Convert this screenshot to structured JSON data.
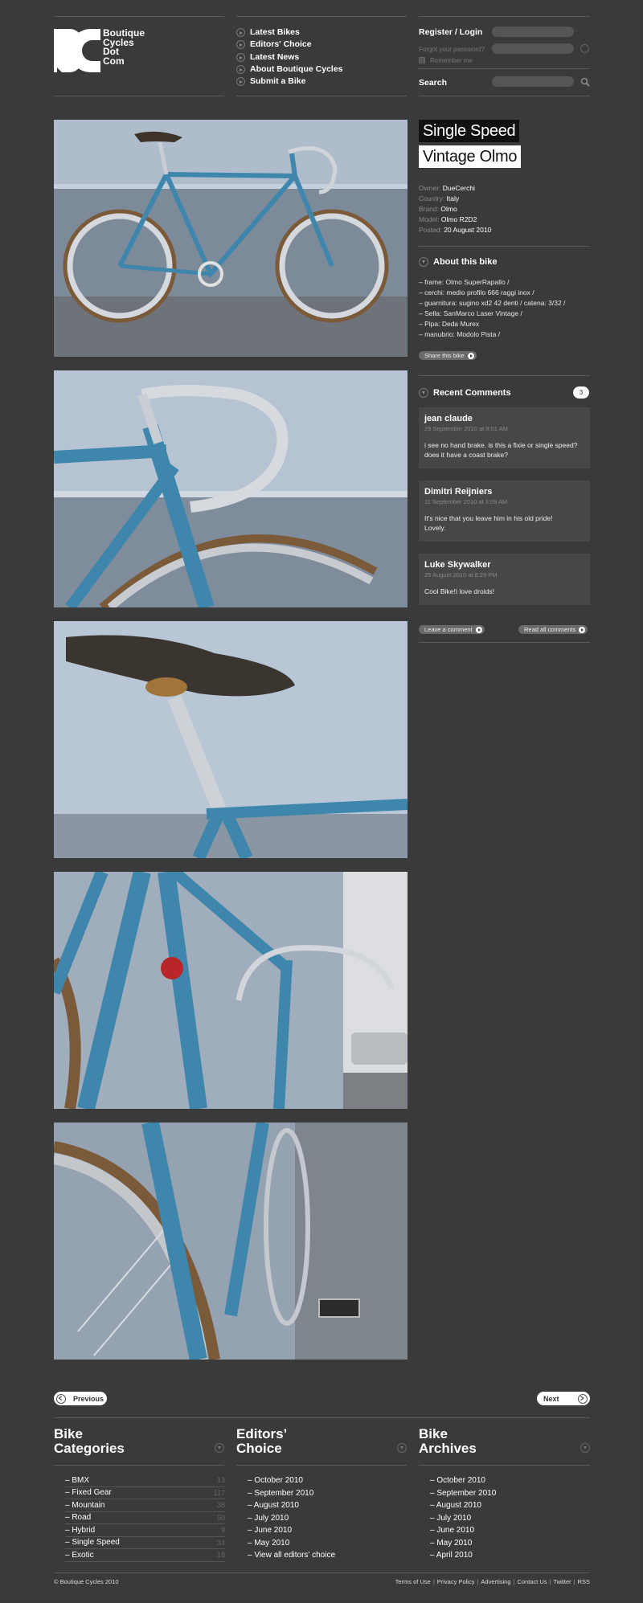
{
  "brand": {
    "line1": "Boutique",
    "line2": "Cycles",
    "line3": "Dot",
    "line4": "Com"
  },
  "nav": [
    {
      "label": "Latest Bikes"
    },
    {
      "label": "Editors' Choice"
    },
    {
      "label": "Latest News"
    },
    {
      "label": "About Boutique Cycles"
    },
    {
      "label": "Submit a Bike"
    }
  ],
  "login": {
    "title": "Register / Login",
    "forgot": "Forgot your password?",
    "remember": "Remember me",
    "search_label": "Search"
  },
  "bike": {
    "title_line1": "Single Speed",
    "title_line2": "Vintage Olmo",
    "meta": [
      {
        "key": "Owner:",
        "value": "DueCerchi"
      },
      {
        "key": "Country:",
        "value": "Italy"
      },
      {
        "key": "Brand:",
        "value": "Olmo"
      },
      {
        "key": "Model:",
        "value": "Olmo R2D2"
      },
      {
        "key": "Posted:",
        "value": "20 August 2010"
      }
    ],
    "about_title": "About this bike",
    "specs": [
      "– frame: Olmo SuperRapallo /",
      "– cerchi: medio profilo 666 raggi inox /",
      "– guarnitura: sugino xd2 42 denti / catena: 3/32 /",
      "– Sella: SanMarco Laser Vintage /",
      "– Pipa: Deda Murex",
      "– manubrio: Modolo Pista /"
    ],
    "share_label": "Share this bike"
  },
  "comments": {
    "title": "Recent Comments",
    "count": "3",
    "items": [
      {
        "name": "jean claude",
        "date": "29 September 2010  at  9:01 AM",
        "text_line1": "i see no hand brake. is this a fixie or single speed?",
        "text_line2": "does it have a coast brake?"
      },
      {
        "name": "Dimitri Reijniers",
        "date": "11 September 2010  at  1:09 AM",
        "text_line1": "It's nice that you leave him in his old pride!",
        "text_line2": "Lovely."
      },
      {
        "name": "Luke Skywalker",
        "date": "25 August 2010  at  8:29 PM",
        "text_line1": "Cool Bike!I love droids!",
        "text_line2": ""
      }
    ],
    "leave_label": "Leave a comment",
    "read_all_label": "Read all comments"
  },
  "pager": {
    "prev": "Previous",
    "next": "Next"
  },
  "footer": {
    "categories_title_1": "Bike",
    "categories_title_2": "Categories",
    "categories": [
      {
        "label": "– BMX",
        "count": "13"
      },
      {
        "label": "– Fixed Gear",
        "count": "117"
      },
      {
        "label": "– Mountain",
        "count": "38"
      },
      {
        "label": "– Road",
        "count": "50"
      },
      {
        "label": "– Hybrid",
        "count": "9"
      },
      {
        "label": "– Single Speed",
        "count": "34"
      },
      {
        "label": "– Exotic",
        "count": "18"
      }
    ],
    "editors_title_1": "Editors’",
    "editors_title_2": "Choice",
    "editors": [
      "– October 2010",
      "– September 2010",
      "– August 2010",
      "– July 2010",
      "– June 2010",
      "– May 2010",
      "– View all editors' choice"
    ],
    "archives_title_1": "Bike",
    "archives_title_2": "Archives",
    "archives": [
      "– October 2010",
      "– September 2010",
      "– August 2010",
      "– July 2010",
      "– June 2010",
      "– May 2010",
      "– April 2010"
    ],
    "copyright": "© Boutique Cycles 2010",
    "links": [
      "Terms of Use",
      "Privacy Policy",
      "Advertising",
      "Contact Us",
      "Twitter",
      "RSS"
    ]
  },
  "colors": {
    "background": "#3a3a3a",
    "frame_blue": "#3f86ad",
    "wall": "#a8b6c6"
  }
}
